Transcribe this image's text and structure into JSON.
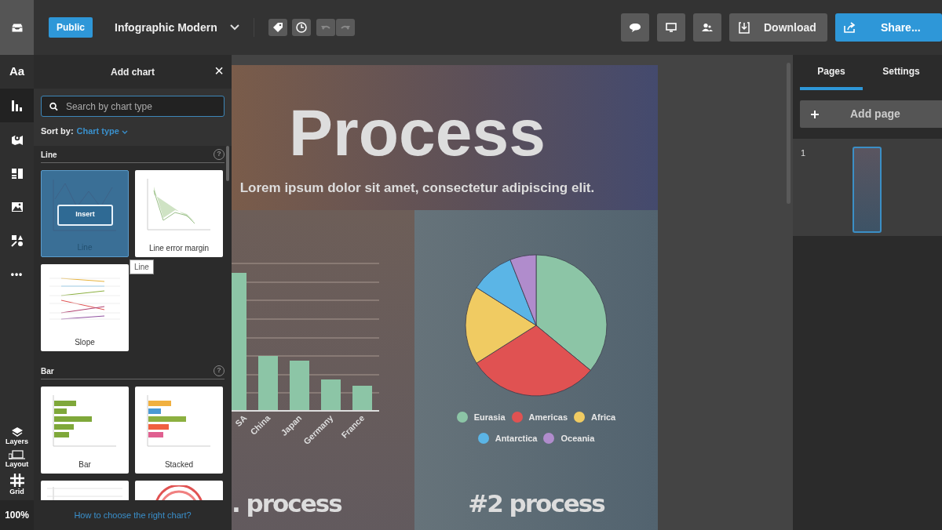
{
  "topbar": {
    "visibility": "Public",
    "title": "Infographic Modern",
    "download": "Download",
    "share": "Share..."
  },
  "rail": {
    "items": [
      {
        "label": "Aa",
        "selected": false
      },
      {
        "selected": true
      },
      {
        "selected": false
      },
      {
        "selected": false
      },
      {
        "selected": false
      },
      {
        "selected": false
      },
      {
        "label": "•••",
        "selected": false
      }
    ],
    "tools": [
      {
        "label": "Layers"
      },
      {
        "label": "Layout"
      },
      {
        "label": "Grid"
      }
    ],
    "zoom": "100%"
  },
  "panel": {
    "title": "Add chart",
    "close": "×",
    "search": {
      "placeholder": "Search by chart type"
    },
    "sort_label": "Sort by:",
    "sort_value": "Chart type",
    "insert": "Insert",
    "tooltip": "Line",
    "help": "?",
    "sections": [
      {
        "title": "Line",
        "cards": [
          {
            "kind": "line",
            "label": "Line",
            "selected": true
          },
          {
            "kind": "error",
            "label": "Line error margin",
            "selected": false
          },
          {
            "kind": "slope",
            "label": "Slope",
            "selected": false
          }
        ]
      },
      {
        "title": "Bar",
        "cards": [
          {
            "kind": "bar",
            "label": "Bar",
            "selected": false
          },
          {
            "kind": "stacked",
            "label": "Stacked",
            "selected": false
          },
          {
            "kind": "column",
            "selected": false
          },
          {
            "kind": "radial",
            "selected": false
          }
        ]
      }
    ],
    "footer": "How to choose the right chart?"
  },
  "canvas": {
    "title": "Process",
    "subtitle": "Lorem ipsum dolor sit amet, consectetur adipiscing elit.",
    "bar_labels": [
      "SA",
      "China",
      "Japan",
      "Germany",
      "France"
    ],
    "legend": [
      {
        "label": "Eurasia",
        "color": "#8cc5a6"
      },
      {
        "label": "Americas",
        "color": "#e05252"
      },
      {
        "label": "Africa",
        "color": "#f0cb62"
      },
      {
        "label": "Antarctica",
        "color": "#5bb5e6"
      },
      {
        "label": "Oceania",
        "color": "#b08ccc"
      }
    ],
    "headings": [
      ". process",
      "#2 process"
    ]
  },
  "right": {
    "tabs": [
      {
        "label": "Pages",
        "selected": true
      },
      {
        "label": "Settings",
        "selected": false
      }
    ],
    "add_page": "Add page",
    "pages": [
      {
        "number": "1",
        "selected": true
      }
    ]
  }
}
